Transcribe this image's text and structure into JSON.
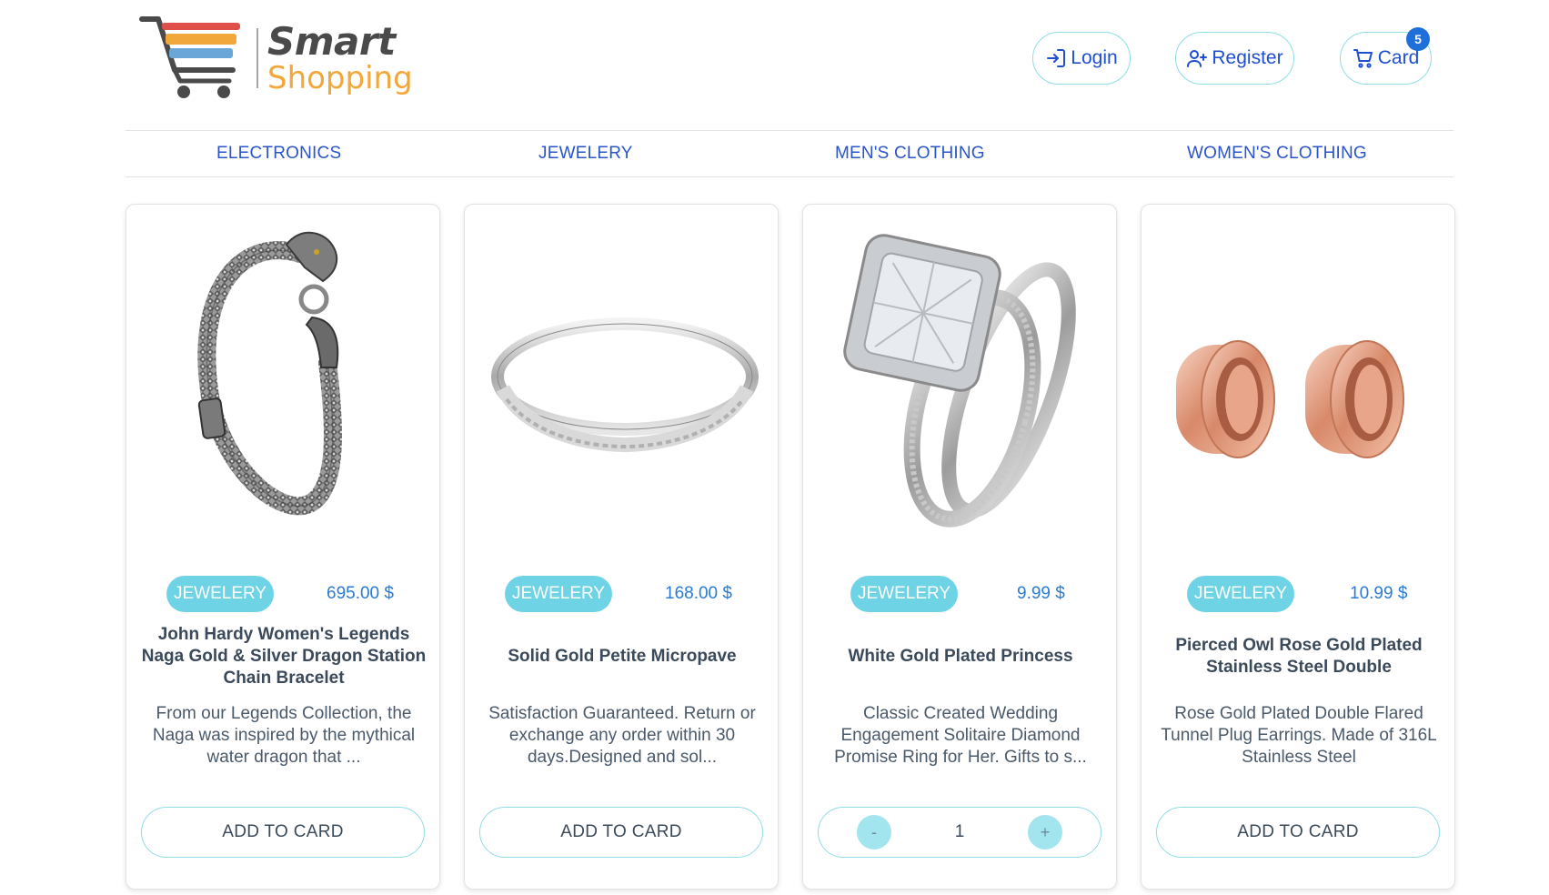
{
  "brand": {
    "word1": "Smart",
    "word2": "Shopping",
    "colors": {
      "orange": "#f2a73b",
      "red": "#e0504a",
      "blue": "#6aa7d8",
      "gray": "#4a4a4a"
    }
  },
  "header": {
    "login_label": "Login",
    "register_label": "Register",
    "cart_label": "Card",
    "cart_count": "5",
    "icons": {
      "login": "login-icon",
      "register": "person-add-icon",
      "cart": "cart-icon"
    }
  },
  "categories": [
    "ELECTRONICS",
    "JEWELERY",
    "MEN'S CLOTHING",
    "WOMEN'S CLOTHING"
  ],
  "products": [
    {
      "category": "JEWELERY",
      "price": "695.00 $",
      "title": "John Hardy Women's Legends Naga Gold & Silver Dragon Station Chain Bracelet",
      "description": "From our Legends Collection, the Naga was inspired by the mythical water dragon that ...",
      "action": "ADD TO CARD",
      "image": "dragon-bracelet-image"
    },
    {
      "category": "JEWELERY",
      "price": "168.00 $",
      "title": "Solid Gold Petite Micropave",
      "description": "Satisfaction Guaranteed. Return or exchange any order within 30 days.Designed and sol...",
      "action": "ADD TO CARD",
      "image": "micropave-ring-image"
    },
    {
      "category": "JEWELERY",
      "price": "9.99 $",
      "title": "White Gold Plated Princess",
      "description": "Classic Created Wedding Engagement Solitaire Diamond Promise Ring for Her. Gifts to s...",
      "quantity": "1",
      "minus_label": "-",
      "plus_label": "+",
      "image": "princess-ring-image"
    },
    {
      "category": "JEWELERY",
      "price": "10.99 $",
      "title": "Pierced Owl Rose Gold Plated Stainless Steel Double",
      "description": "Rose Gold Plated Double Flared Tunnel Plug Earrings. Made of 316L Stainless Steel",
      "action": "ADD TO CARD",
      "image": "tunnel-plug-earrings-image"
    }
  ]
}
